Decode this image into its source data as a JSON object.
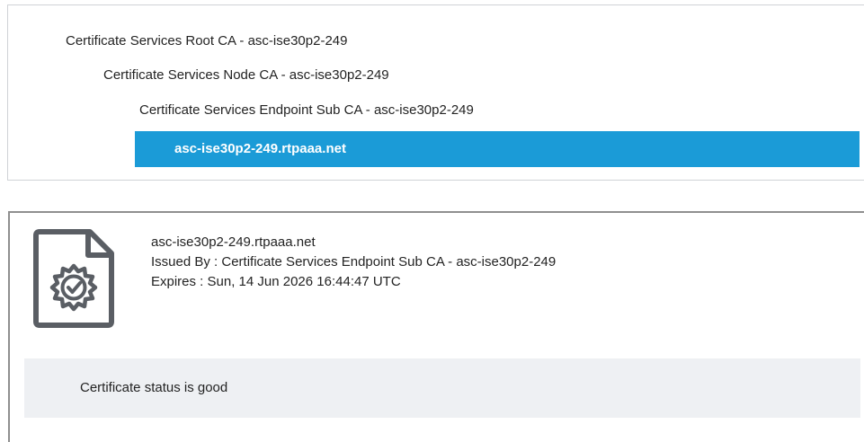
{
  "hierarchy": {
    "nodes": [
      {
        "label": "Certificate Services Root CA - asc-ise30p2-249",
        "selected": false
      },
      {
        "label": "Certificate Services Node CA - asc-ise30p2-249",
        "selected": false
      },
      {
        "label": "Certificate Services Endpoint Sub CA - asc-ise30p2-249",
        "selected": false
      },
      {
        "label": "asc-ise30p2-249.rtpaaa.net",
        "selected": true
      }
    ]
  },
  "certificate": {
    "icon": "certificate-badge-icon",
    "name": "asc-ise30p2-249.rtpaaa.net",
    "issued_by": "Issued By : Certificate Services Endpoint Sub CA - asc-ise30p2-249",
    "expires": "Expires : Sun, 14 Jun 2026 16:44:47 UTC",
    "status": "Certificate status is good"
  },
  "colors": {
    "selection": "#1b9bd7",
    "icon": "#5a5e64",
    "status_background": "#eef0f3"
  }
}
